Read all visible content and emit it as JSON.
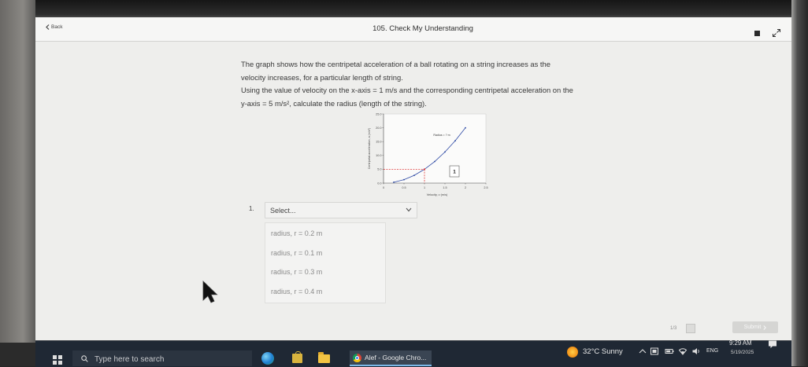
{
  "window": {
    "back_label": "Back",
    "title": "105. Check My Understanding"
  },
  "question": {
    "prompt_lines": [
      "The graph shows how the centripetal acceleration of a ball rotating on a string increases as the",
      "velocity increases, for a particular length of string.",
      "Using the value of velocity on the x-axis = 1 m/s and the corresponding centripetal acceleration on the",
      "y-axis = 5 m/s², calculate the radius (length of the string)."
    ],
    "number": "1.",
    "select": {
      "placeholder": "Select...",
      "options": [
        "radius, r = 0.2 m",
        "radius, r = 0.1 m",
        "radius, r = 0.3 m",
        "radius, r = 0.4 m"
      ]
    }
  },
  "chart_data": {
    "type": "line",
    "xlabel": "Velocity, v (m/s)",
    "ylabel": "Centripetal acceleration, a (m/s²)",
    "annotation": "Radius = ? m",
    "hotspot_label": "1",
    "x_ticks": [
      "0",
      "0.5",
      "1",
      "1.5",
      "2",
      "2.5"
    ],
    "y_ticks": [
      "0.0",
      "5.0",
      "10.0",
      "15.0",
      "20.0",
      "25.0"
    ],
    "xlim": [
      0,
      2.5
    ],
    "ylim": [
      0,
      25
    ],
    "x": [
      0.25,
      0.5,
      0.75,
      1,
      1.25,
      1.5,
      1.75,
      2
    ],
    "series": [
      {
        "values": [
          0.31,
          1.25,
          2.81,
          5,
          7.81,
          11.25,
          15.31,
          20
        ]
      }
    ],
    "reference_point": {
      "x": 1,
      "y": 5
    },
    "grid": false,
    "series_color": "#2b47a3",
    "reference_color": "#e03a3a"
  },
  "footer": {
    "page_indicator": "1/3",
    "submit_label": "Submit"
  },
  "taskbar": {
    "search_placeholder": "Type here to search",
    "active_app_title": "Alef - Google Chro...",
    "weather": "32°C Sunny",
    "language": "ENG",
    "time": "9:29 AM",
    "date": "5/19/2025"
  },
  "icons": {
    "back": "chevron-left-icon",
    "select_toggle": "chevron-down-icon",
    "submit": "chevron-right-icon",
    "pinned": [
      "edge-icon",
      "store-icon",
      "file-explorer-icon",
      "chrome-icon"
    ],
    "tray": [
      "chevron-up-icon",
      "tray-app-icon",
      "battery-icon",
      "wifi-icon",
      "volume-icon",
      "notification-icon"
    ]
  },
  "colors": {
    "taskbar": "#1f2834",
    "active_app_underline": "#7cb9e8",
    "weather_sun": "#f08a12"
  }
}
